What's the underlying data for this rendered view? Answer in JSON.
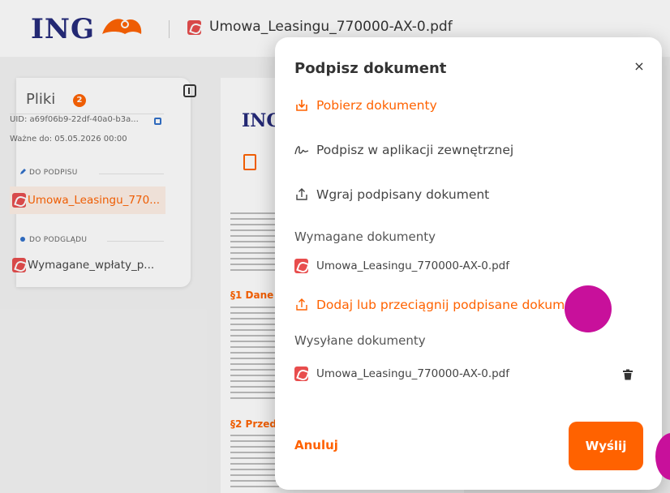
{
  "header": {
    "logo": "ING",
    "document_title": "Umowa_Leasingu_770000-AX-0.pdf"
  },
  "sidebar": {
    "title": "Pliki",
    "badge": "2",
    "uid": "UID: a69f06b9-22df-40a0-b3a...",
    "valid_until": "Ważne do: 05.05.2026 00:00",
    "section_sign": "DO PODPISU",
    "file_sign": "Umowa_Leasingu_770...",
    "section_preview": "DO PODGLĄDU",
    "file_preview": "Wymagane_wpłaty_p..."
  },
  "document_preview": {
    "logo": "ING",
    "heading1": "§1 Dane",
    "heading2": "§2 Przed"
  },
  "modal": {
    "title": "Podpisz dokument",
    "close": "×",
    "download": "Pobierz dokumenty",
    "external_sign": "Podpisz w aplikacji zewnętrznej",
    "upload_signed": "Wgraj podpisany dokument",
    "required_label": "Wymagane dokumenty",
    "required_file": "Umowa_Leasingu_770000-AX-0.pdf",
    "add_files": "Dodaj lub przeciągnij podpisane dokumenty",
    "sent_label": "Wysyłane dokumenty",
    "sent_file": "Umowa_Leasingu_770000-AX-0.pdf",
    "cancel": "Anuluj",
    "send": "Wyślij"
  },
  "colors": {
    "accent": "#ff6200",
    "brand_blue": "#23297a",
    "pdf_red": "#e84d4d"
  },
  "icons": [
    "lion-logo-icon",
    "pdf-icon",
    "download-icon",
    "signature-icon",
    "upload-icon",
    "trash-icon",
    "close-icon",
    "copy-icon",
    "sidebar-collapse-icon"
  ]
}
